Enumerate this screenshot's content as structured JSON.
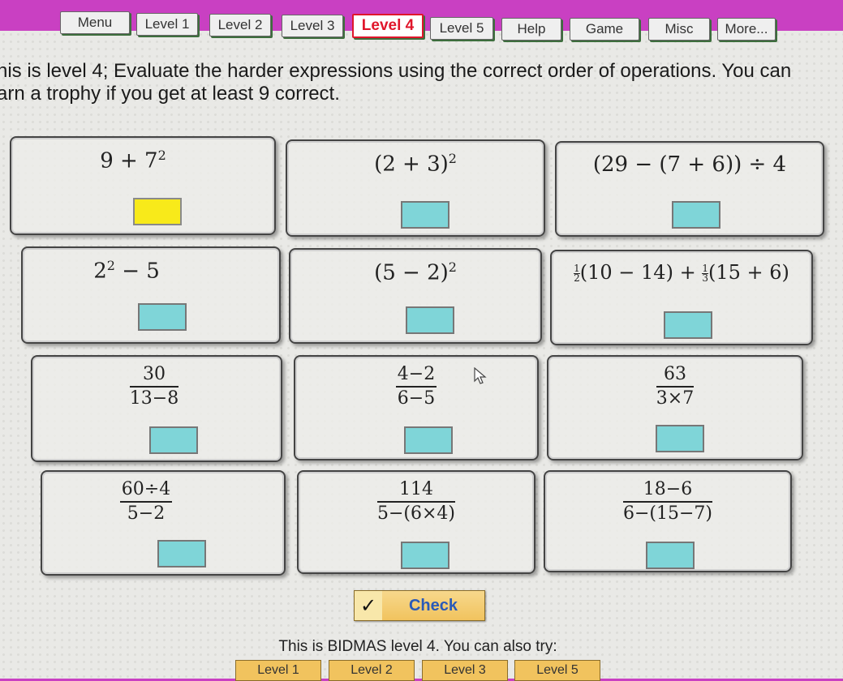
{
  "tabs": [
    {
      "label": "Menu"
    },
    {
      "label": "Level 1"
    },
    {
      "label": "Level 2"
    },
    {
      "label": "Level 3"
    },
    {
      "label": "Level 4",
      "active": true
    },
    {
      "label": "Level 5"
    },
    {
      "label": "Help"
    },
    {
      "label": "Game"
    },
    {
      "label": "Misc"
    },
    {
      "label": "More..."
    }
  ],
  "intro": {
    "line1": "his is level 4; Evaluate the harder expressions using the correct order of operations. You can",
    "line2": "arn a trophy if you get at least 9 correct."
  },
  "problems": [
    {
      "base": "9 + 7",
      "exp": "2",
      "state": "selected"
    },
    {
      "base": "(2 + 3)",
      "exp": "2"
    },
    {
      "text": "(29 − (7 + 6)) ÷ 4"
    },
    {
      "base": "2",
      "exp": "2",
      "tail": " − 5"
    },
    {
      "base": "(5 − 2)",
      "exp": "2"
    },
    {
      "halfA": "1",
      "halfB": "2",
      "mid": "(10 − 14) + ",
      "thirdA": "1",
      "thirdB": "3",
      "tail": "(15 + 6)"
    },
    {
      "num": "30",
      "den": "13−8"
    },
    {
      "num": "4−2",
      "den": "6−5"
    },
    {
      "num": "63",
      "den": "3×7"
    },
    {
      "num": "60÷4",
      "den": "5−2"
    },
    {
      "num": "114",
      "den": "5−(6×4)"
    },
    {
      "num": "18−6",
      "den": "6−(15−7)"
    }
  ],
  "check": {
    "icon": "checkmark-icon",
    "symbol": "✓",
    "label": "Check"
  },
  "footer": {
    "text": "This is BIDMAS level 4. You can also try:",
    "links": [
      "Level 1",
      "Level 2",
      "Level 3",
      "Level 5"
    ]
  },
  "colors": {
    "background": "#c940c2",
    "active_tab": "#e0162b",
    "answer_box": "#7fd5d8",
    "selected_answer": "#f8ea1a",
    "check_button": "#f1c35e"
  }
}
